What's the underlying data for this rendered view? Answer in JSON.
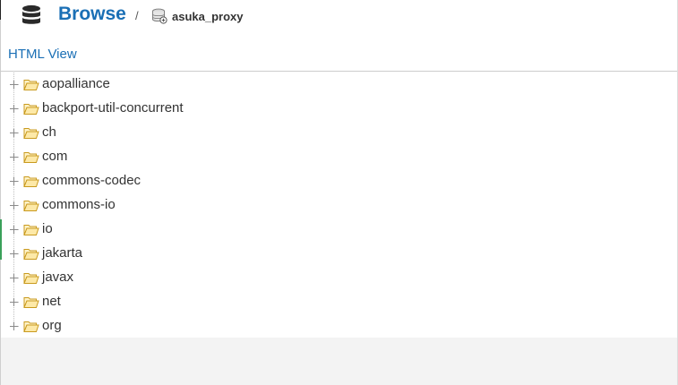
{
  "header": {
    "title": "Browse",
    "separator": "/",
    "repository": "asuka_proxy"
  },
  "view_toggle": "HTML View",
  "tree": {
    "items": [
      "aopalliance",
      "backport-util-concurrent",
      "ch",
      "com",
      "commons-codec",
      "commons-io",
      "io",
      "jakarta",
      "javax",
      "net",
      "org"
    ]
  },
  "colors": {
    "accent": "#1a6fb5",
    "folder_fill": "#fde9a8",
    "folder_stroke": "#c99a1e"
  },
  "icons": {
    "header": "database-icon",
    "repository": "repository-icon",
    "node_expander": "plus-expander-icon",
    "node_folder": "folder-open-icon"
  }
}
